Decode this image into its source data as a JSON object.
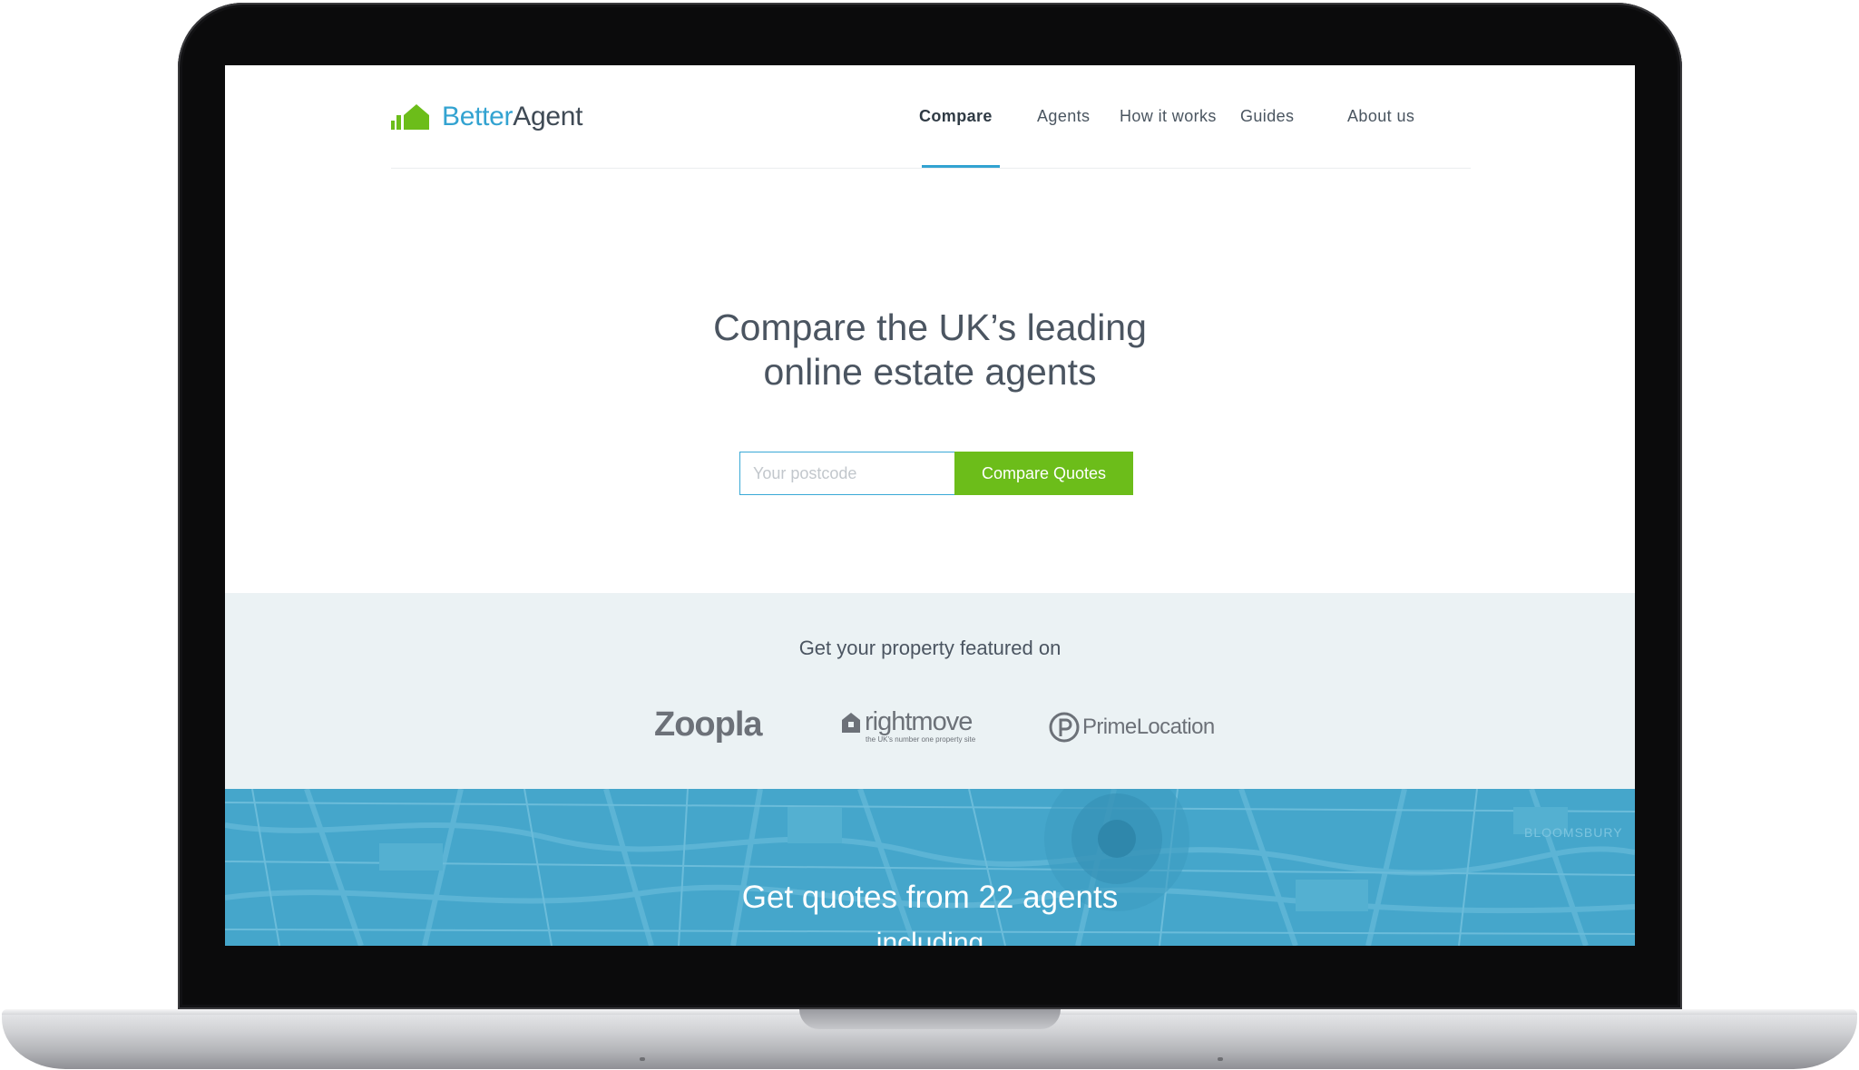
{
  "brand": {
    "better": "Better",
    "agent": "Agent"
  },
  "nav": {
    "items": [
      {
        "label": "Compare",
        "active": true
      },
      {
        "label": "Agents"
      },
      {
        "label": "How it works"
      },
      {
        "label": "Guides"
      },
      {
        "label": "About us"
      }
    ]
  },
  "hero": {
    "title_line1": "Compare the UK’s leading",
    "title_line2": "online estate agents",
    "postcode_placeholder": "Your postcode",
    "button_label": "Compare Quotes"
  },
  "featured": {
    "title": "Get your property featured on",
    "logos": {
      "zoopla": "Zoopla",
      "rightmove": "rightmove",
      "rightmove_tagline": "the UK's number one property site",
      "primelocation_a": "Prime",
      "primelocation_b": "Location"
    }
  },
  "map": {
    "title": "Get quotes from 22 agents",
    "subtitle_partial": "including",
    "area_label": "BLOOMSBURY"
  },
  "colors": {
    "accent_blue": "#33a3d1",
    "green": "#6cbd1a",
    "map_blue": "#45a6cb",
    "featured_bg": "#ebf2f4"
  }
}
